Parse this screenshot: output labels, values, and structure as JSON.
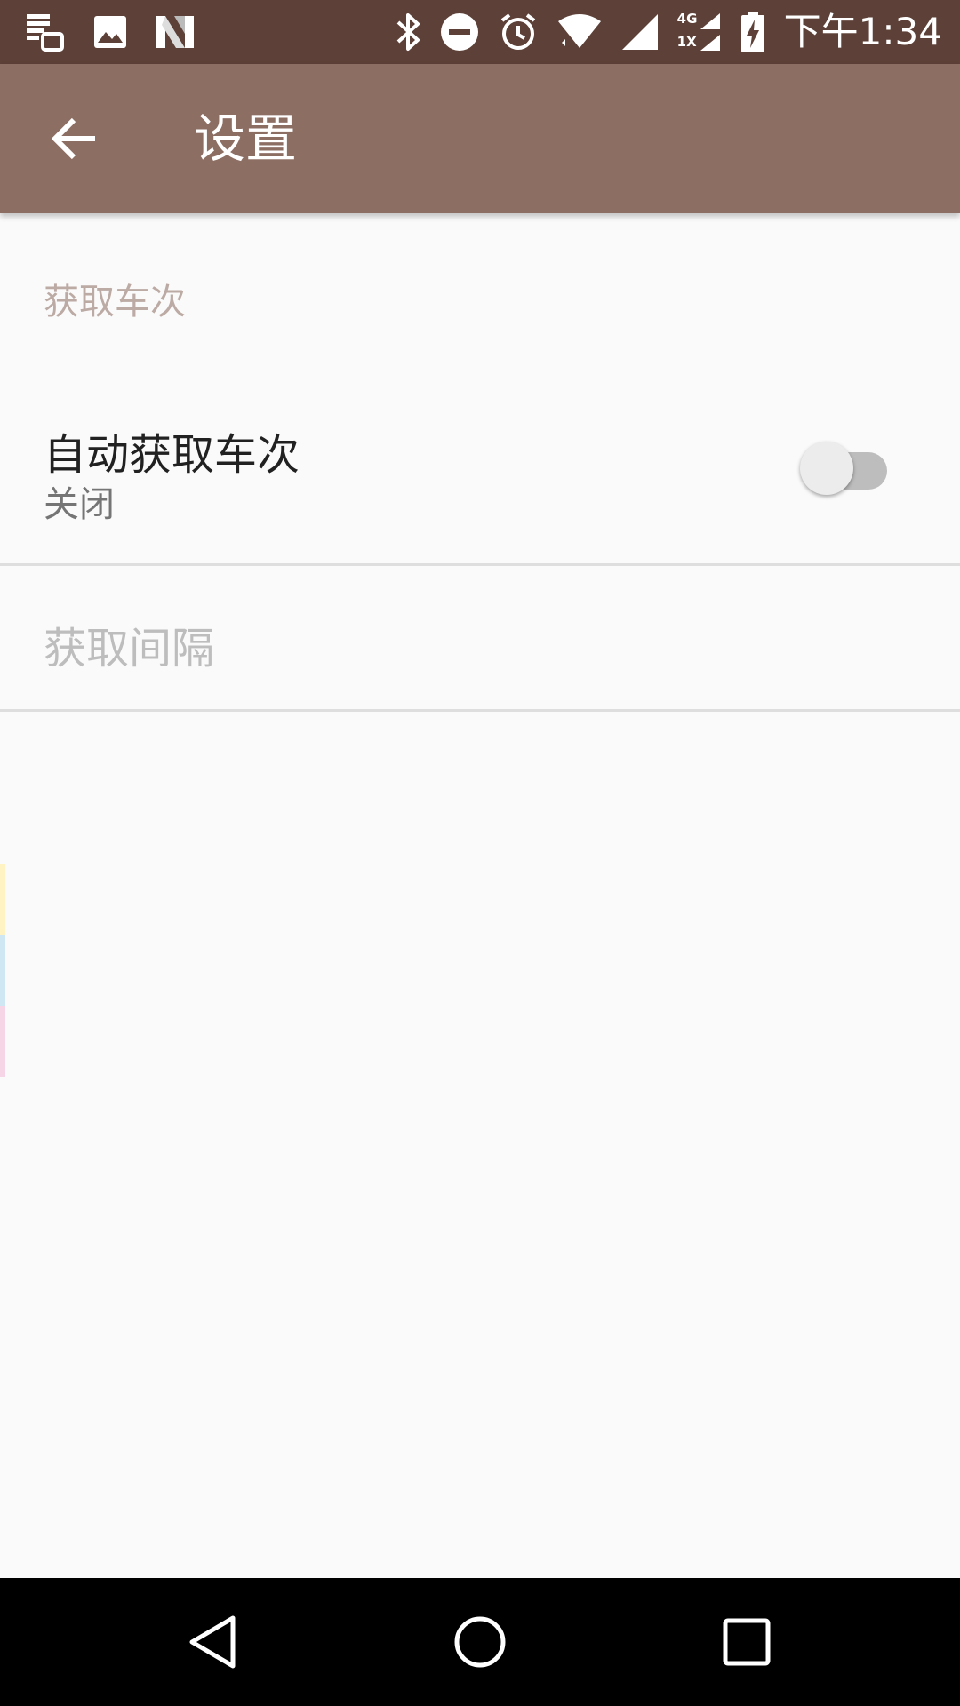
{
  "status_bar": {
    "time": "下午1:34",
    "network_label_top": "4G",
    "network_label_bottom": "1X",
    "icons": [
      "notes-icon",
      "image-icon",
      "n-logo-icon",
      "bluetooth-icon",
      "do-not-disturb-icon",
      "alarm-icon",
      "wifi-icon",
      "signal-icon",
      "signal-4g-icon",
      "battery-charging-icon"
    ]
  },
  "app_bar": {
    "title": "设置",
    "back_icon": "arrow-back-icon",
    "background_color": "#8d6e63"
  },
  "settings": {
    "category_title": "获取车次",
    "auto_fetch": {
      "title": "自动获取车次",
      "summary": "关闭",
      "switch_on": false
    },
    "interval": {
      "title": "获取间隔",
      "enabled": false
    }
  },
  "colors": {
    "status_bar": "#5d4037",
    "accent": "#bcaaa4",
    "stripe_yellow": "#fff3c4",
    "stripe_blue": "#cfe6f3",
    "stripe_pink": "#f6d5e6"
  },
  "nav_bar": {
    "icons": [
      "back-triangle-icon",
      "home-circle-icon",
      "recents-square-icon"
    ]
  }
}
